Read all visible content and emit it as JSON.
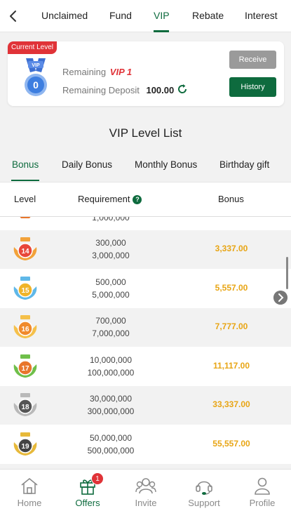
{
  "nav": {
    "tabs": [
      {
        "label": "Unclaimed"
      },
      {
        "label": "Fund"
      },
      {
        "label": "VIP"
      },
      {
        "label": "Rebate"
      },
      {
        "label": "Interest"
      }
    ],
    "active_tab": "VIP"
  },
  "card": {
    "badge": "Current Level",
    "medal_level": "0",
    "medal_label": "VIP",
    "remaining_label": "Remaining",
    "remaining_vip": "VIP 1",
    "deposit_label": "Remaining Deposit",
    "deposit_value": "100.00",
    "receive_label": "Receive",
    "history_label": "History"
  },
  "list": {
    "title": "VIP Level List",
    "tabs": [
      {
        "label": "Bonus"
      },
      {
        "label": "Daily Bonus"
      },
      {
        "label": "Monthly Bonus"
      },
      {
        "label": "Birthday gift"
      }
    ],
    "active_tab": "Bonus",
    "headers": {
      "level": "Level",
      "requirement": "Requirement",
      "bonus": "Bonus"
    },
    "partial_row": {
      "req_bottom": "1,000,000"
    },
    "rows": [
      {
        "level": "14",
        "req1": "300,000",
        "req2": "3,000,000",
        "bonus": "3,337.00"
      },
      {
        "level": "15",
        "req1": "500,000",
        "req2": "5,000,000",
        "bonus": "5,557.00"
      },
      {
        "level": "16",
        "req1": "700,000",
        "req2": "7,000,000",
        "bonus": "7,777.00"
      },
      {
        "level": "17",
        "req1": "10,000,000",
        "req2": "100,000,000",
        "bonus": "11,117.00"
      },
      {
        "level": "18",
        "req1": "30,000,000",
        "req2": "300,000,000",
        "bonus": "33,337.00"
      },
      {
        "level": "19",
        "req1": "50,000,000",
        "req2": "500,000,000",
        "bonus": "55,557.00"
      }
    ]
  },
  "bottom_nav": {
    "items": [
      {
        "label": "Home",
        "icon": "home-icon"
      },
      {
        "label": "Offers",
        "icon": "gift-icon"
      },
      {
        "label": "Invite",
        "icon": "users-icon"
      },
      {
        "label": "Support",
        "icon": "headset-icon"
      },
      {
        "label": "Profile",
        "icon": "user-icon"
      }
    ],
    "active": "Offers",
    "offers_badge": "1"
  },
  "colors": {
    "brand_green": "#0e6b3e",
    "accent_red": "#e03338",
    "bonus_gold": "#e8a514"
  }
}
